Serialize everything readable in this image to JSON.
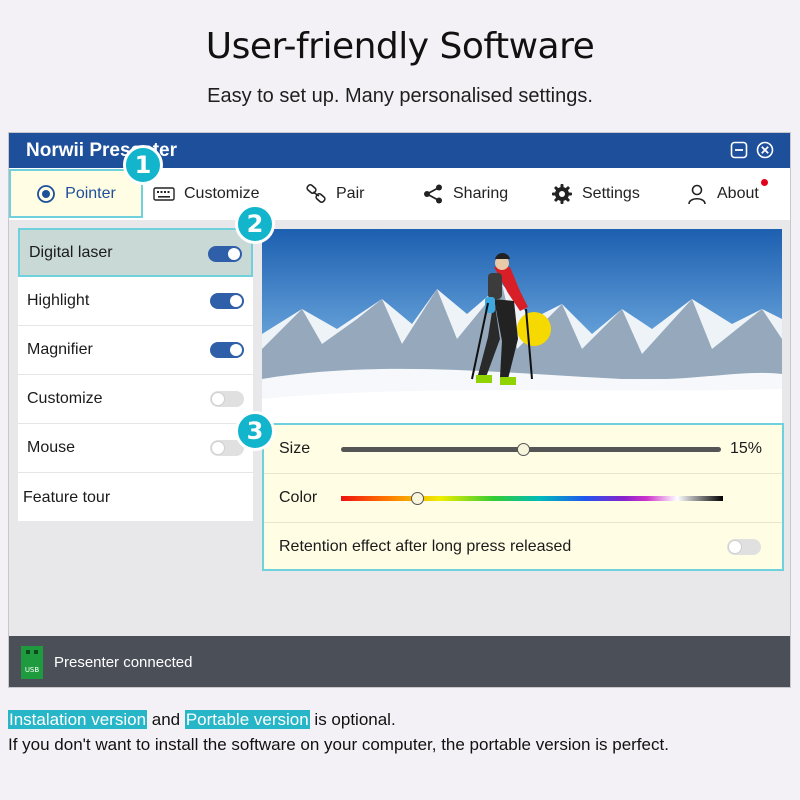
{
  "hero": {
    "title": "User-friendly Software",
    "subtitle": "Easy to set up. Many personalised settings."
  },
  "window": {
    "title": "Norwii Presenter",
    "controls": [
      "minimize-icon",
      "close-icon"
    ]
  },
  "nav": {
    "tabs": [
      {
        "label": "Pointer",
        "icon": "radio-target-icon",
        "selected": true
      },
      {
        "label": "Customize",
        "icon": "keyboard-icon"
      },
      {
        "label": "Pair",
        "icon": "link-icon"
      },
      {
        "label": "Sharing",
        "icon": "share-icon"
      },
      {
        "label": "Settings",
        "icon": "gear-icon"
      },
      {
        "label": "About",
        "icon": "user-icon",
        "notification_dot": true
      }
    ]
  },
  "badges": [
    "1",
    "2",
    "3"
  ],
  "sidebar": {
    "items": [
      {
        "label": "Digital laser",
        "enabled": true,
        "active": true
      },
      {
        "label": "Highlight",
        "enabled": true
      },
      {
        "label": "Magnifier",
        "enabled": true
      },
      {
        "label": "Customize",
        "enabled": false
      },
      {
        "label": "Mouse",
        "enabled": false
      }
    ],
    "feature_tour": "Feature tour"
  },
  "settings": {
    "size_label": "Size",
    "size_value": "15%",
    "size_slider_fraction": 0.48,
    "color_label": "Color",
    "color_slider_fraction": 0.2,
    "retention_label": "Retention effect after long press released",
    "retention_enabled": false
  },
  "status": {
    "icon": "usb-icon",
    "usb_label": "USB",
    "text": "Presenter connected"
  },
  "footer": {
    "install_version": "Instalation version",
    "and": " and ",
    "portable_version": "Portable version",
    "optional": " is optional.",
    "line2": "If you don't want to install the software on your computer, the portable version is perfect."
  },
  "colors": {
    "titlebar": "#1d4f9a",
    "accent_cyan": "#12b5cb",
    "toggle_on": "#2f5fa9",
    "panel_bg": "#fffde4",
    "laser_dot": "#f5d900"
  }
}
